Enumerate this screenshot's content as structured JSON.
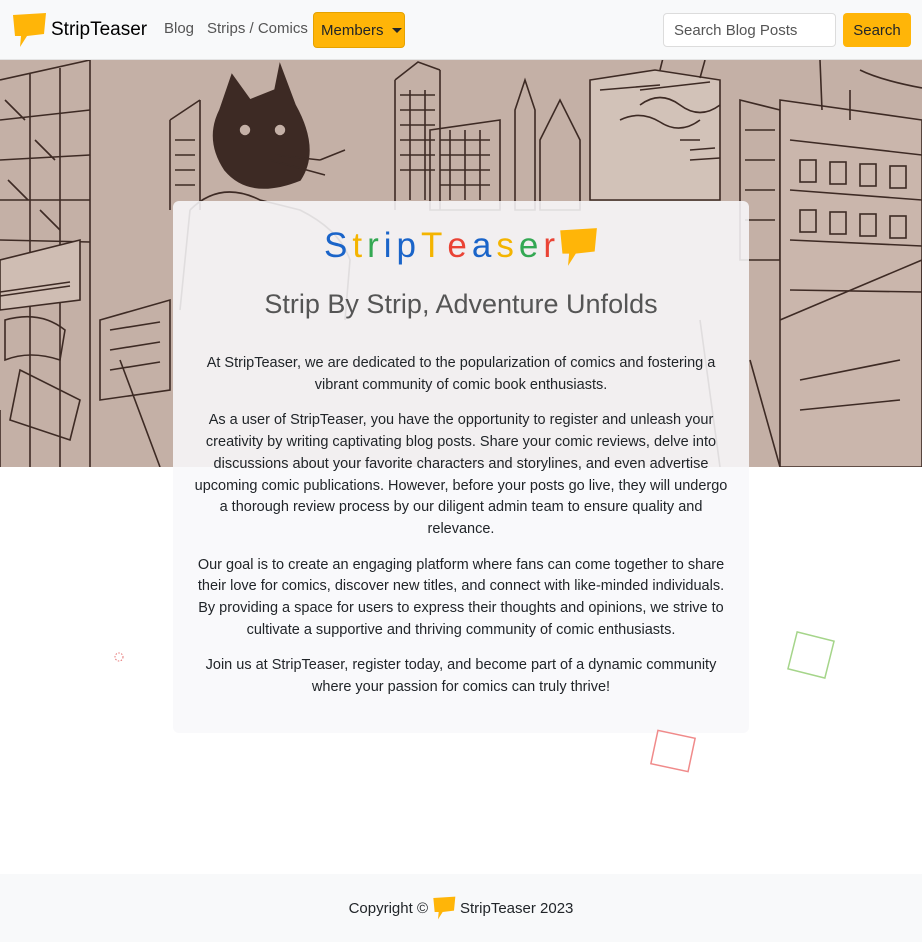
{
  "navbar": {
    "brand": "StripTeaser",
    "links": [
      "Blog",
      "Strips / Comics"
    ],
    "members_label": "Members",
    "search_placeholder": "Search Blog Posts",
    "search_button": "Search"
  },
  "hero": {
    "logo_letters": [
      "S",
      "t",
      "r",
      "i",
      "p",
      "T",
      "e",
      "a",
      "s",
      "e",
      "r"
    ],
    "logo_colors": [
      "#1a64c9",
      "#f4b400",
      "#34a853",
      "#1a64c9",
      "#1a64c9",
      "#f4b400",
      "#ea4335",
      "#1a64c9",
      "#f4b400",
      "#34a853",
      "#ea4335"
    ],
    "title": "Strip By Strip, Adventure Unfolds",
    "paragraphs": [
      "At StripTeaser, we are dedicated to the popularization of comics and fostering a vibrant community of comic book enthusiasts.",
      "As a user of StripTeaser, you have the opportunity to register and unleash your creativity by writing captivating blog posts. Share your comic reviews, delve into discussions about your favorite characters and storylines, and even advertise upcoming comic publications. However, before your posts go live, they will undergo a thorough review process by our diligent admin team to ensure quality and relevance.",
      "Our goal is to create an engaging platform where fans can come together to share their love for comics, discover new titles, and connect with like-minded individuals. By providing a space for users to express their thoughts and opinions, we strive to cultivate a supportive and thriving community of comic enthusiasts.",
      "Join us at StripTeaser, register today, and become part of a dynamic community where your passion for comics can truly thrive!"
    ]
  },
  "footer": {
    "prefix": "Copyright ©",
    "suffix": "StripTeaser 2023"
  },
  "colors": {
    "accent": "#ffb508",
    "hero_bg": "#bfaaa0"
  }
}
